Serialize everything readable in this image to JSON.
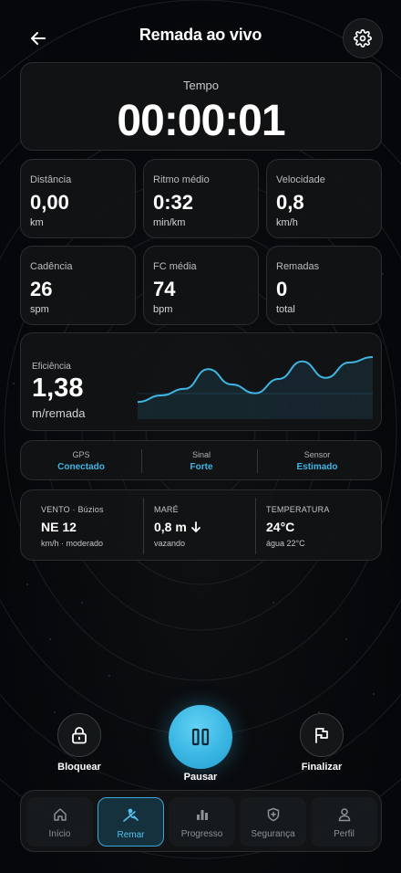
{
  "header": {
    "title": "Remada ao vivo",
    "back_icon": "arrow-left-icon",
    "settings_icon": "gear-icon"
  },
  "timer": {
    "label": "Tempo",
    "value": "00:00:01"
  },
  "metrics": [
    {
      "label": "Distância",
      "value": "0,00",
      "unit": "km"
    },
    {
      "label": "Ritmo médio",
      "value": "0:32",
      "unit": "min/km"
    },
    {
      "label": "Velocidade",
      "value": "0,8",
      "unit": "km/h"
    },
    {
      "label": "Cadência",
      "value": "26",
      "unit": "spm"
    },
    {
      "label": "FC média",
      "value": "74",
      "unit": "bpm"
    },
    {
      "label": "Remadas",
      "value": "0",
      "unit": "total"
    }
  ],
  "efficiency": {
    "label": "Eficiência",
    "value": "1,38",
    "unit": "m/remada",
    "chart_data": {
      "type": "area",
      "series": [
        {
          "values": [
            0.18,
            0.3,
            0.42,
            0.78,
            0.5,
            0.34,
            0.6,
            0.92,
            0.62,
            0.9,
            1.0
          ]
        }
      ],
      "color": "#3fb5e3",
      "grid": true
    }
  },
  "status": [
    {
      "label": "GPS",
      "value": "Conectado"
    },
    {
      "label": "Sinal",
      "value": "Forte"
    },
    {
      "label": "Sensor",
      "value": "Estimado"
    }
  ],
  "conditions": [
    {
      "label": "VENTO · Búzios",
      "value": "NE 12",
      "sub": "km/h · moderado"
    },
    {
      "label": "MARÉ",
      "value": "0,8 m",
      "sub": "vazando",
      "icon": "arrow-down-icon"
    },
    {
      "label": "TEMPERATURA",
      "value": "24°C",
      "sub": "água 22°C"
    }
  ],
  "controls": {
    "lock_label": "Bloquear",
    "pause_label": "Pausar",
    "finish_label": "Finalizar"
  },
  "tabs": [
    {
      "label": "Início",
      "icon": "home-icon",
      "active": false
    },
    {
      "label": "Remar",
      "icon": "rowing-icon",
      "active": true
    },
    {
      "label": "Progresso",
      "icon": "bar-chart-icon",
      "active": false
    },
    {
      "label": "Segurança",
      "icon": "shield-plus-icon",
      "active": false
    },
    {
      "label": "Perfil",
      "icon": "user-icon",
      "active": false
    }
  ],
  "colors": {
    "accent": "#3fb5e3",
    "background": "#070809",
    "card": "#121415"
  }
}
